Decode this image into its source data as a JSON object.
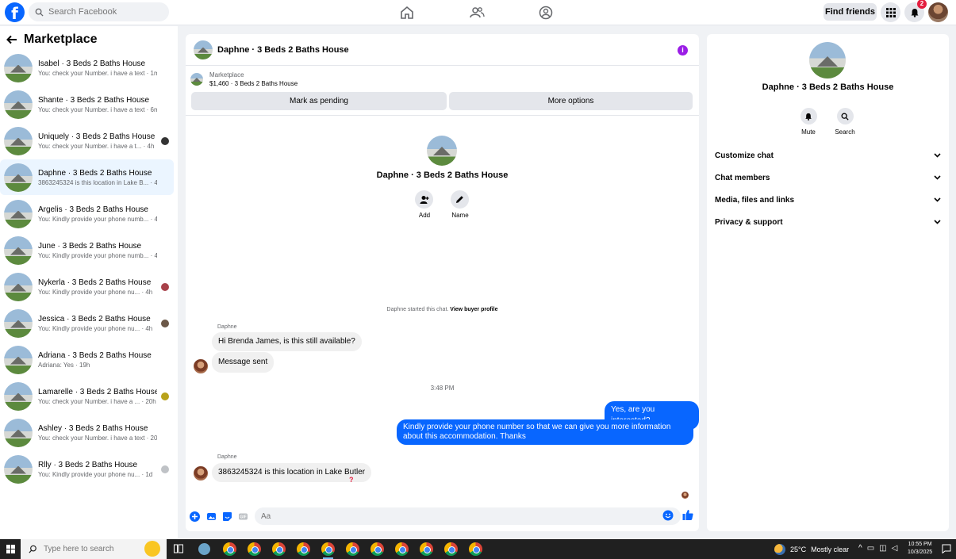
{
  "topbar": {
    "logo": "f",
    "search_placeholder": "Search Facebook",
    "find_friends": "Find friends",
    "notification_count": "2",
    "nav_icons": [
      "home-icon",
      "friends-icon",
      "groups-icon"
    ]
  },
  "sidebar": {
    "title": "Marketplace",
    "conversations": [
      {
        "name": "Isabel · 3 Beds 2 Baths House",
        "preview": "You: check your Number. i have a text · 1m"
      },
      {
        "name": "Shante · 3 Beds 2 Baths House",
        "preview": "You: check your Number. i have a text · 6m"
      },
      {
        "name": "Uniquely · 3 Beds 2 Baths House",
        "preview": "You: check your Number. i have a t... · 4h"
      },
      {
        "name": "Daphne · 3 Beds 2 Baths House",
        "preview": "3863245324 is this location in Lake B... · 4h"
      },
      {
        "name": "Argelis · 3 Beds 2 Baths House",
        "preview": "You: Kindly provide your phone numb... · 4h"
      },
      {
        "name": "June · 3 Beds 2 Baths House",
        "preview": "You: Kindly provide your phone numb... · 4h"
      },
      {
        "name": "Nykerla · 3 Beds 2 Baths House",
        "preview": "You: Kindly provide your phone nu... · 4h"
      },
      {
        "name": "Jessica · 3 Beds 2 Baths House",
        "preview": "You: Kindly provide your phone nu... · 4h"
      },
      {
        "name": "Adriana · 3 Beds 2 Baths House",
        "preview": "Adriana: Yes · 19h"
      },
      {
        "name": "Lamarelle · 3 Beds 2 Baths House",
        "preview": "You: check your Number. i have a ... · 20h"
      },
      {
        "name": "Ashley · 3 Beds 2 Baths House",
        "preview": "You: check your Number. i have a text · 20h"
      },
      {
        "name": "Rlly · 3 Beds 2 Baths House",
        "preview": "You: Kindly provide your phone nu... · 1d"
      }
    ]
  },
  "chat": {
    "title": "Daphne · 3 Beds 2 Baths House",
    "listing_source": "Marketplace",
    "listing_detail": "$1,460 · 3 Beds 2 Baths House",
    "mark_pending": "Mark as pending",
    "more_options": "More options",
    "center_title": "Daphne · 3 Beds 2 Baths House",
    "add_label": "Add",
    "name_label": "Name",
    "started_text": "Daphne started this chat.",
    "view_profile": "View buyer profile",
    "sender": "Daphne",
    "msg1": "Hi Brenda James, is this still available?",
    "msg2": "Message sent",
    "time": "3:48 PM",
    "out1": "Yes, are you interested?",
    "out2": "Kindly provide your phone number so that we can give you more information about this accommodation. Thanks",
    "sender2": "Daphne",
    "msg3": "3863245324 is this location in Lake Butler",
    "reaction": "?",
    "composer_placeholder": "Aa"
  },
  "details": {
    "title": "Daphne · 3 Beds 2 Baths House",
    "mute": "Mute",
    "search": "Search",
    "sections": [
      "Customize chat",
      "Chat members",
      "Media, files and links",
      "Privacy & support"
    ]
  },
  "taskbar": {
    "search_placeholder": "Type here to search",
    "temperature": "25°C",
    "weather": "Mostly clear",
    "time": "10:55 PM",
    "date": "10/3/2025"
  },
  "colors": {
    "accent": "#0866ff",
    "info": "#9b1ee6",
    "badge": "#e41e3f"
  }
}
